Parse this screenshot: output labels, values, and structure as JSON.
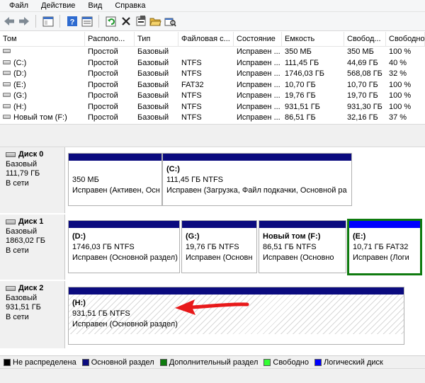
{
  "menu": [
    "Файл",
    "Действие",
    "Вид",
    "Справка"
  ],
  "toolbar": {
    "icons": [
      "back-arrow-icon",
      "forward-arrow-icon",
      "console-icon",
      "help-icon",
      "properties-list-icon",
      "refresh-icon",
      "delete-icon",
      "properties-icon",
      "open-folder-icon",
      "explore-icon"
    ]
  },
  "table": {
    "columns": [
      "Том",
      "Располо...",
      "Тип",
      "Файловая с...",
      "Состояние",
      "Емкость",
      "Свобод...",
      "Свободно %"
    ],
    "rows": [
      [
        "",
        "Простой",
        "Базовый",
        "",
        "Исправен ...",
        "350 МБ",
        "350 МБ",
        "100 %"
      ],
      [
        "(C:)",
        "Простой",
        "Базовый",
        "NTFS",
        "Исправен ...",
        "111,45 ГБ",
        "44,69 ГБ",
        "40 %"
      ],
      [
        "(D:)",
        "Простой",
        "Базовый",
        "NTFS",
        "Исправен ...",
        "1746,03 ГБ",
        "568,08 ГБ",
        "32 %"
      ],
      [
        "(E:)",
        "Простой",
        "Базовый",
        "FAT32",
        "Исправен ...",
        "10,70 ГБ",
        "10,70 ГБ",
        "100 %"
      ],
      [
        "(G:)",
        "Простой",
        "Базовый",
        "NTFS",
        "Исправен ...",
        "19,76 ГБ",
        "19,70 ГБ",
        "100 %"
      ],
      [
        "(H:)",
        "Простой",
        "Базовый",
        "NTFS",
        "Исправен ...",
        "931,51 ГБ",
        "931,30 ГБ",
        "100 %"
      ],
      [
        "Новый том (F:)",
        "Простой",
        "Базовый",
        "NTFS",
        "Исправен ...",
        "86,51 ГБ",
        "32,16 ГБ",
        "37 %"
      ]
    ]
  },
  "disks": [
    {
      "name": "Диск 0",
      "type": "Базовый",
      "size": "111,79 ГБ",
      "status": "В сети",
      "partitions": [
        {
          "name": "",
          "size": "350 МБ",
          "state": "Исправен (Активен, Осн"
        },
        {
          "name": "(C:)",
          "size": "111,45 ГБ NTFS",
          "state": "Исправен (Загрузка, Файл подкачки, Основной ра"
        }
      ]
    },
    {
      "name": "Диск 1",
      "type": "Базовый",
      "size": "1863,02 ГБ",
      "status": "В сети",
      "partitions": [
        {
          "name": "(D:)",
          "size": "1746,03 ГБ NTFS",
          "state": "Исправен (Основной раздел)"
        },
        {
          "name": "(G:)",
          "size": "19,76 ГБ NTFS",
          "state": "Исправен (Основн"
        },
        {
          "name": "Новый том  (F:)",
          "size": "86,51 ГБ NTFS",
          "state": "Исправен (Основно"
        },
        {
          "name": "(E:)",
          "size": "10,71 ГБ FAT32",
          "state": "Исправен (Логи"
        }
      ]
    },
    {
      "name": "Диск 2",
      "type": "Базовый",
      "size": "931,51 ГБ",
      "status": "В сети",
      "partitions": [
        {
          "name": "(H:)",
          "size": "931,51 ГБ NTFS",
          "state": "Исправен (Основной раздел)"
        }
      ]
    }
  ],
  "legend": [
    {
      "label": "Не распределена",
      "color": "#000000"
    },
    {
      "label": "Основной раздел",
      "color": "#0b0b7f"
    },
    {
      "label": "Дополнительный раздел",
      "color": "#0f7b0f"
    },
    {
      "label": "Свободно",
      "color": "#33ff33"
    },
    {
      "label": "Логический диск",
      "color": "#0000ff"
    }
  ],
  "colors": {
    "primary_partition": "#0b0b7f",
    "logical_partition": "#0000ff",
    "selected_border": "#0f7b0f",
    "annotation_arrow": "#e8191a"
  }
}
